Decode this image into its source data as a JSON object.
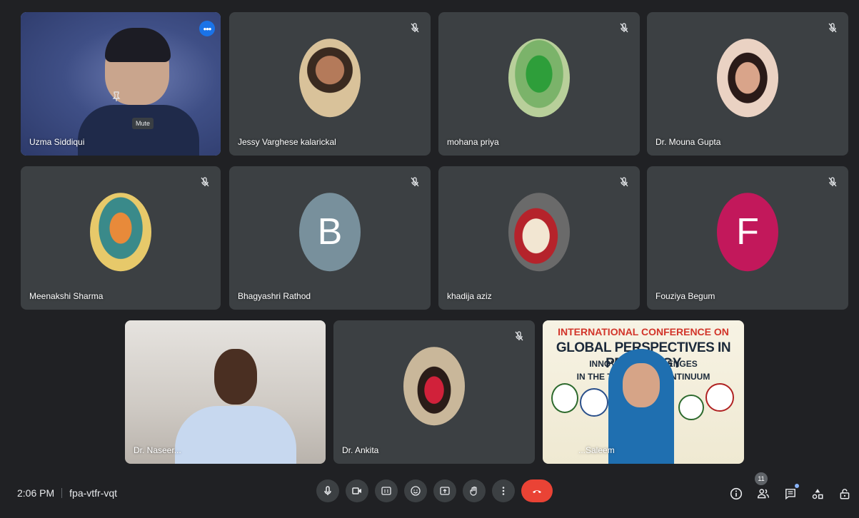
{
  "participants": [
    {
      "name": "Uzma Siddiqui"
    },
    {
      "name": "Jessy Varghese kalarickal"
    },
    {
      "name": "mohana priya"
    },
    {
      "name": "Dr. Mouna Gupta"
    },
    {
      "name": "Meenakshi Sharma"
    },
    {
      "name": "Bhagyashri Rathod",
      "initial": "B"
    },
    {
      "name": "khadija aziz"
    },
    {
      "name": "Fouziya Begum",
      "initial": "F"
    },
    {
      "name": "Dr. Naseer..."
    },
    {
      "name": "Dr. Ankita"
    },
    {
      "name": "...Saleem"
    }
  ],
  "tooltip": "Mute",
  "banner": {
    "line1": "INTERNATIONAL CONFERENCE ON",
    "line2": "GLOBAL PERSPECTIVES IN PEDAGOGY",
    "line3": "INNOVATI... CHALLENGES",
    "line4": "IN THE TEAC... ING CONTINUUM"
  },
  "meeting": {
    "time": "2:06 PM",
    "code": "fpa-vtfr-vqt"
  },
  "people_count": "11",
  "colors": {
    "background": "#202124",
    "tile": "#3c4043",
    "active_outline": "#8ab4f8",
    "end_call": "#ea4335",
    "avatar_b": "#78909c",
    "avatar_f": "#c2185b"
  },
  "icons": [
    "more-vert-icon",
    "mic-off-icon",
    "pin-icon",
    "mic-icon",
    "camera-icon",
    "captions-icon",
    "emoji-icon",
    "present-icon",
    "raise-hand-icon",
    "more-options-icon",
    "end-call-icon",
    "info-icon",
    "people-icon",
    "chat-icon",
    "activities-icon",
    "host-controls-icon"
  ]
}
